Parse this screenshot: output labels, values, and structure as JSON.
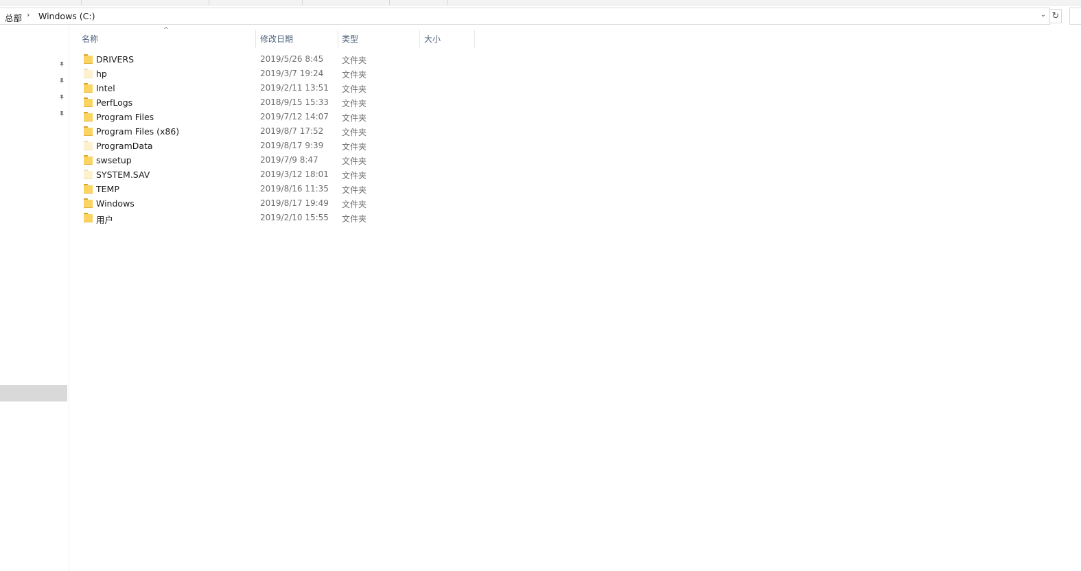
{
  "breadcrumb": {
    "root": "总部",
    "separator": "›",
    "current": "Windows (C:)"
  },
  "address_bar": {
    "dropdown_glyph": "⌄",
    "refresh_glyph": "↻"
  },
  "columns": {
    "name": "名称",
    "modified": "修改日期",
    "type": "类型",
    "size": "大小",
    "sort_glyph": "^"
  },
  "nav": {
    "pin_glyph": "📌"
  },
  "files": [
    {
      "name": "DRIVERS",
      "modified": "2019/5/26 8:45",
      "type": "文件夹",
      "hidden": false
    },
    {
      "name": "hp",
      "modified": "2019/3/7 19:24",
      "type": "文件夹",
      "hidden": true
    },
    {
      "name": "Intel",
      "modified": "2019/2/11 13:51",
      "type": "文件夹",
      "hidden": false
    },
    {
      "name": "PerfLogs",
      "modified": "2018/9/15 15:33",
      "type": "文件夹",
      "hidden": false
    },
    {
      "name": "Program Files",
      "modified": "2019/7/12 14:07",
      "type": "文件夹",
      "hidden": false
    },
    {
      "name": "Program Files (x86)",
      "modified": "2019/8/7 17:52",
      "type": "文件夹",
      "hidden": false
    },
    {
      "name": "ProgramData",
      "modified": "2019/8/17 9:39",
      "type": "文件夹",
      "hidden": true
    },
    {
      "name": "swsetup",
      "modified": "2019/7/9 8:47",
      "type": "文件夹",
      "hidden": false
    },
    {
      "name": "SYSTEM.SAV",
      "modified": "2019/3/12 18:01",
      "type": "文件夹",
      "hidden": true
    },
    {
      "name": "TEMP",
      "modified": "2019/8/16 11:35",
      "type": "文件夹",
      "hidden": false
    },
    {
      "name": "Windows",
      "modified": "2019/8/17 19:49",
      "type": "文件夹",
      "hidden": false
    },
    {
      "name": "用户",
      "modified": "2019/2/10 15:55",
      "type": "文件夹",
      "hidden": false
    }
  ]
}
